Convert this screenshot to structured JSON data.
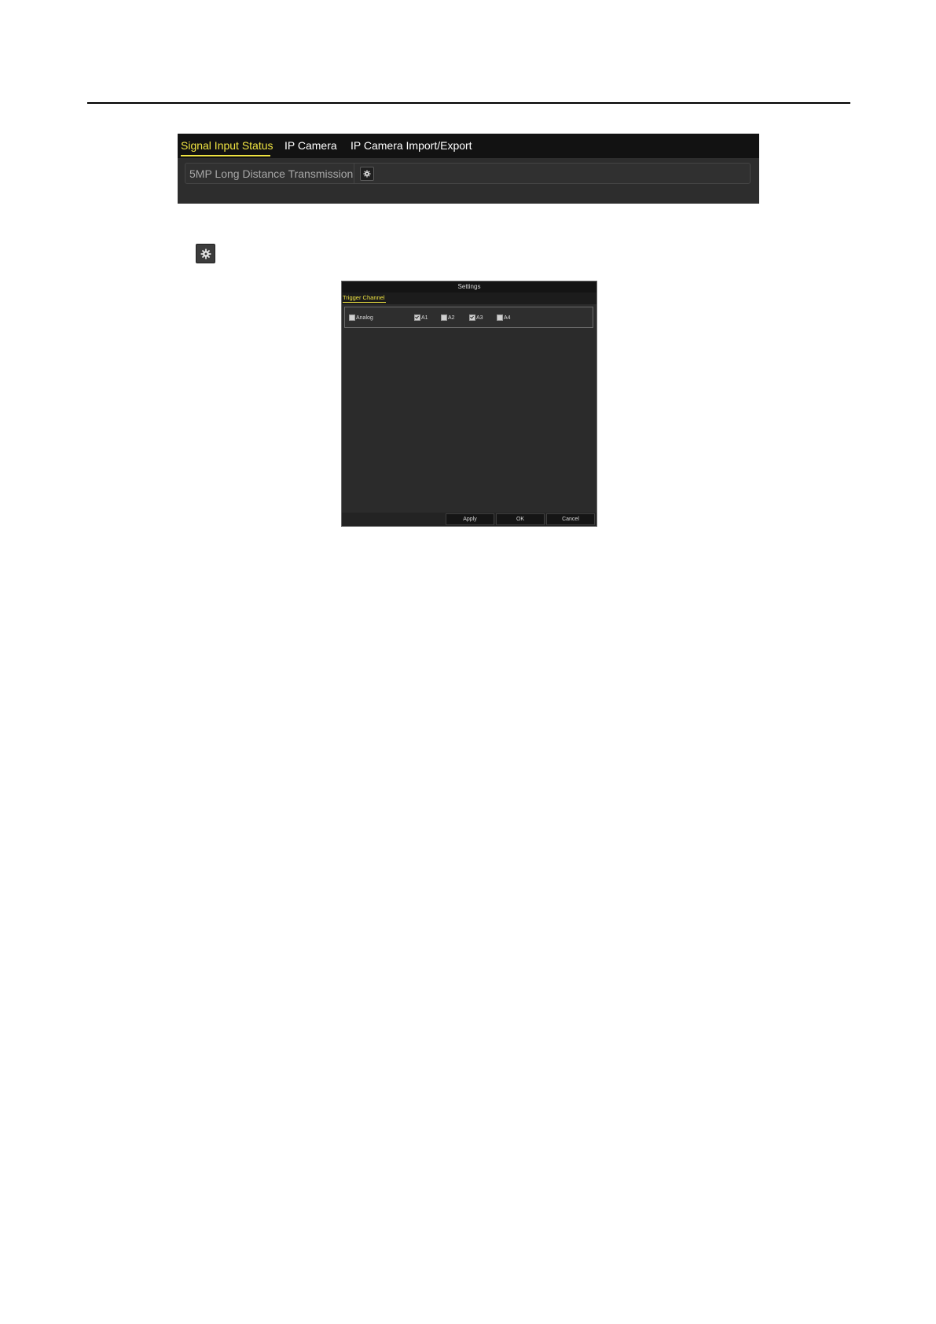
{
  "figure1": {
    "tabs": [
      {
        "label": "Signal Input Status",
        "active": true
      },
      {
        "label": "IP Camera",
        "active": false
      },
      {
        "label": "IP Camera Import/Export",
        "active": false
      }
    ],
    "row_label": "5MP Long Distance Transmission",
    "settings_icon": "gear-icon"
  },
  "standalone_icon": "gear-icon",
  "settings_dialog": {
    "title": "Settings",
    "tab": "Trigger Channel",
    "checkboxes": [
      {
        "label": "Analog",
        "checked": false
      },
      {
        "label": "A1",
        "checked": true
      },
      {
        "label": "A2",
        "checked": false
      },
      {
        "label": "A3",
        "checked": true
      },
      {
        "label": "A4",
        "checked": false
      }
    ],
    "buttons": {
      "apply": "Apply",
      "ok": "OK",
      "cancel": "Cancel"
    }
  },
  "colors": {
    "accent_yellow": "#f0e442",
    "panel_dark": "#2d2d2d",
    "bar_black": "#121212"
  }
}
